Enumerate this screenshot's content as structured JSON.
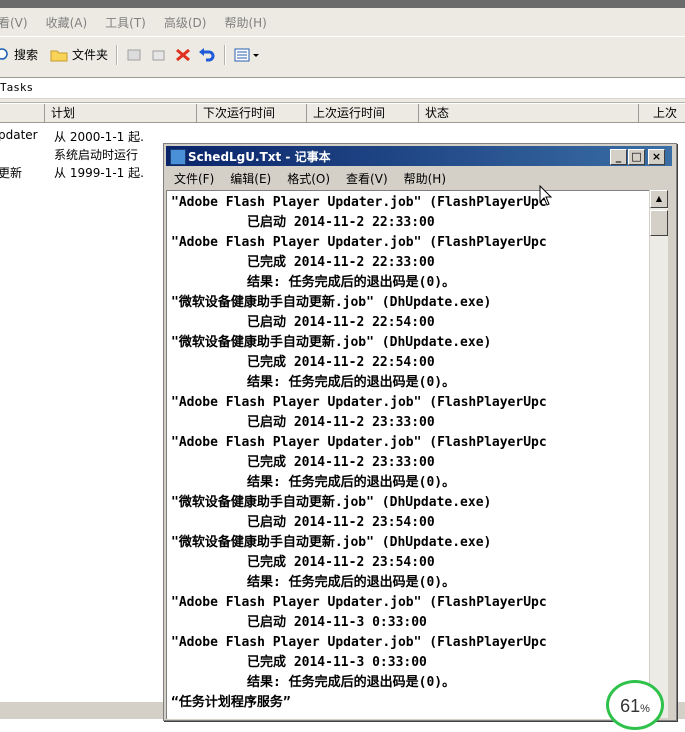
{
  "explorer": {
    "menu": [
      "看(V)",
      "收藏(A)",
      "工具(T)",
      "高级(D)",
      "帮助(H)"
    ],
    "toolbar": {
      "search_label": "搜索",
      "folders_label": "文件夹"
    },
    "address": "Tasks",
    "columns": [
      "计划",
      "下次运行时间",
      "上次运行时间",
      "状态",
      "上次"
    ],
    "rows": [
      {
        "name": "pdater",
        "schedule": "从 2000-1-1 起."
      },
      {
        "name": "",
        "schedule": "系统启动时运行"
      },
      {
        "name": "更新",
        "schedule": "从 1999-1-1 起."
      }
    ]
  },
  "notepad": {
    "title": "SchedLgU.Txt - 记事本",
    "menu": [
      "文件(F)",
      "编辑(E)",
      "格式(O)",
      "查看(V)",
      "帮助(H)"
    ],
    "lines": [
      {
        "text": "\"Adobe Flash Player Updater.job\" (FlashPlayerUpc",
        "indent": false
      },
      {
        "text": "已启动 2014-11-2 22:33:00",
        "indent": true
      },
      {
        "text": "\"Adobe Flash Player Updater.job\" (FlashPlayerUpc",
        "indent": false
      },
      {
        "text": "已完成 2014-11-2 22:33:00",
        "indent": true
      },
      {
        "text": "结果: 任务完成后的退出码是(0)。",
        "indent": true
      },
      {
        "text": "\"微软设备健康助手自动更新.job\" (DhUpdate.exe)",
        "indent": false
      },
      {
        "text": "已启动 2014-11-2 22:54:00",
        "indent": true
      },
      {
        "text": "\"微软设备健康助手自动更新.job\" (DhUpdate.exe)",
        "indent": false
      },
      {
        "text": "已完成 2014-11-2 22:54:00",
        "indent": true
      },
      {
        "text": "结果: 任务完成后的退出码是(0)。",
        "indent": true
      },
      {
        "text": "\"Adobe Flash Player Updater.job\" (FlashPlayerUpc",
        "indent": false
      },
      {
        "text": "已启动 2014-11-2 23:33:00",
        "indent": true
      },
      {
        "text": "\"Adobe Flash Player Updater.job\" (FlashPlayerUpc",
        "indent": false
      },
      {
        "text": "已完成 2014-11-2 23:33:00",
        "indent": true
      },
      {
        "text": "结果: 任务完成后的退出码是(0)。",
        "indent": true
      },
      {
        "text": "\"微软设备健康助手自动更新.job\" (DhUpdate.exe)",
        "indent": false
      },
      {
        "text": "已启动 2014-11-2 23:54:00",
        "indent": true
      },
      {
        "text": "\"微软设备健康助手自动更新.job\" (DhUpdate.exe)",
        "indent": false
      },
      {
        "text": "已完成 2014-11-2 23:54:00",
        "indent": true
      },
      {
        "text": "结果: 任务完成后的退出码是(0)。",
        "indent": true
      },
      {
        "text": "\"Adobe Flash Player Updater.job\" (FlashPlayerUpc",
        "indent": false
      },
      {
        "text": "已启动 2014-11-3 0:33:00",
        "indent": true
      },
      {
        "text": "\"Adobe Flash Player Updater.job\" (FlashPlayerUpc",
        "indent": false
      },
      {
        "text": "已完成 2014-11-3 0:33:00",
        "indent": true
      },
      {
        "text": "结果: 任务完成后的退出码是(0)。",
        "indent": true
      },
      {
        "text": "“任务计划程序服务”",
        "indent": false
      }
    ]
  },
  "badge": {
    "value": "61",
    "unit": "%"
  },
  "colors": {
    "title_gradient_start": "#0a246a",
    "title_gradient_end": "#3a6ea5",
    "badge_ring": "#2ec24a"
  }
}
